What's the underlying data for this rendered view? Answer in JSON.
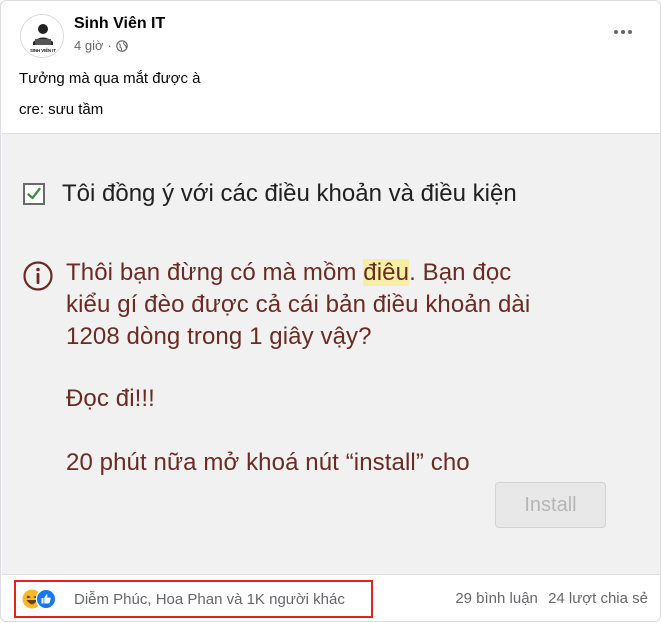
{
  "post": {
    "author": "Sinh Viên IT",
    "avatar_text": "SINH VIÊN IT",
    "time": "4 giờ",
    "caption_line1": "Tưởng mà qua mắt được à",
    "caption_line2": "cre: sưu tầm"
  },
  "image": {
    "agree_text": "Tôi đồng ý với các điều khoản và điều kiện",
    "warning_line1_pre": "Thôi bạn đừng có mà mồm ",
    "warning_line1_highlight": "điêu",
    "warning_line1_post": ". Bạn đọc",
    "warning_line2": "kiểu gí đèo được cả cái bản điều khoản dài",
    "warning_line3": "1208 dòng trong 1 giây vậy?",
    "warning_line4": "Đọc đi!!!",
    "warning_line5": "20 phút nữa mở khoá nút “install” cho",
    "install_label": "Install"
  },
  "footer": {
    "reaction_names": "Diễm Phúc, Hoa Phan và 1K người khác",
    "comments": "29 bình luận",
    "shares": "24 lượt chia sẻ"
  },
  "colors": {
    "warning_text": "#6b2b22",
    "like_blue": "#1877f2",
    "highlight_box": "#e0241d"
  },
  "icons": [
    "globe-icon",
    "more-options-icon",
    "checkbox-checked-icon",
    "info-icon",
    "haha-reaction-icon",
    "like-reaction-icon"
  ]
}
